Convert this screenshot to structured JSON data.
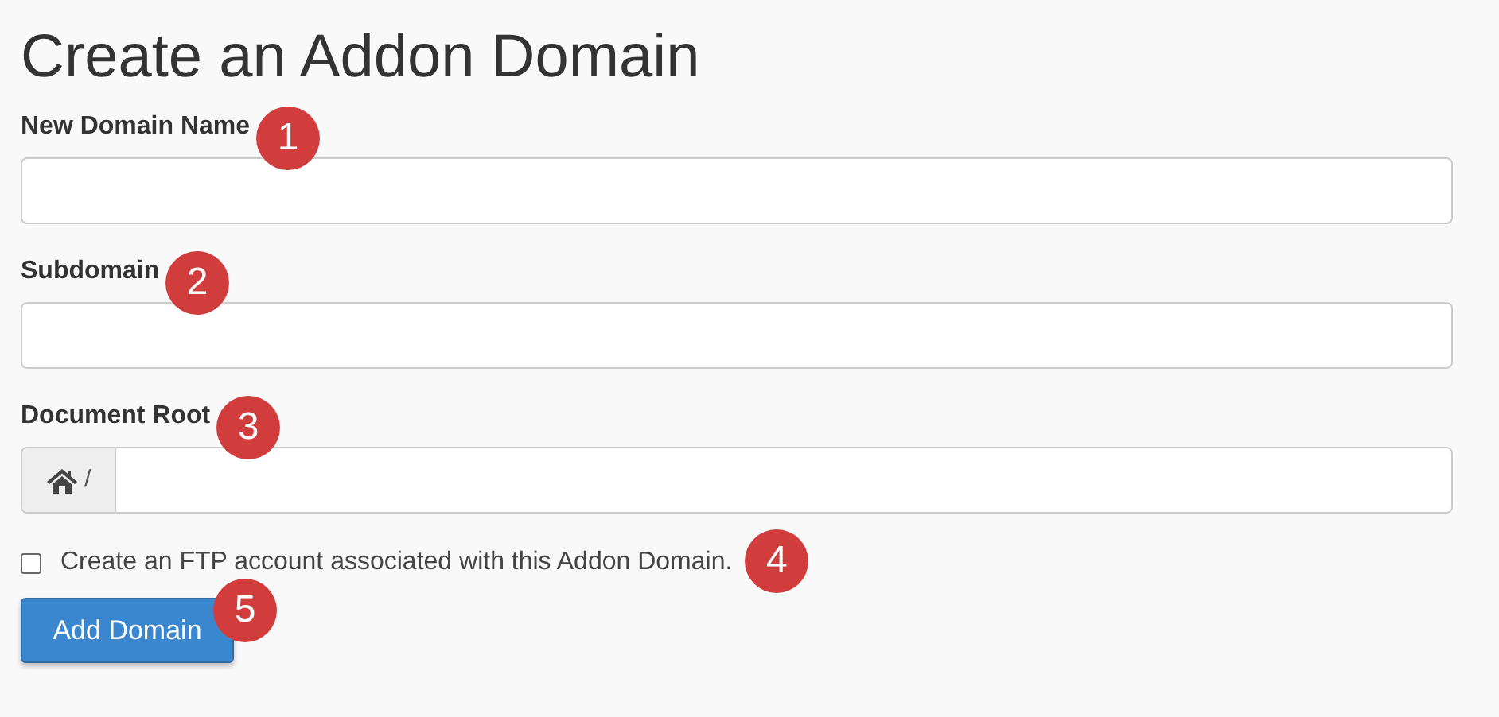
{
  "title": "Create an Addon Domain",
  "fields": [
    {
      "label": "New Domain Name",
      "badge": "1",
      "kind": "text"
    },
    {
      "label": "Subdomain",
      "badge": "2",
      "kind": "text"
    },
    {
      "label": "Document Root",
      "badge": "3",
      "kind": "path",
      "prefix": "/"
    }
  ],
  "ftp_checkbox": {
    "label": "Create an FTP account associated with this Addon Domain.",
    "checked": false,
    "badge": "4"
  },
  "submit": {
    "label": "Add Domain",
    "badge": "5"
  }
}
